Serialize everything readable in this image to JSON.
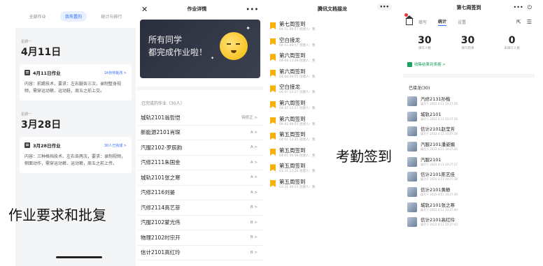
{
  "panel1": {
    "tabs": [
      "全部作业",
      "我布置的",
      "统计与排行"
    ],
    "groups": [
      {
        "weekday": "星期一",
        "date": "4月11日",
        "card_title": "4月11日作业",
        "card_link": "16份待批改 >",
        "card_body": "内容：前踢技术，要求：左右腿各三次，录制整身视频，需穿运动裤、运动鞋，周五之前上交。"
      },
      {
        "weekday": "星期一",
        "date": "3月28日",
        "card_title": "3月28日作业",
        "card_link": "30人已完成 >",
        "card_body": "内容：三种格挡技术、左右各两次，要求：录制视频，侧面动作，需穿运动裤、运动裤，周五之前上传。"
      }
    ],
    "caption": "作业要求和批复"
  },
  "panel2": {
    "title": "作业详情",
    "banner_line1": "所有同学",
    "banner_line2": "都完成作业啦！",
    "section_label": "已完成的作业（30人）",
    "rows": [
      {
        "name": "城轨2101翁哲恺",
        "grade": "待修正 >"
      },
      {
        "name": "新能源2101肖琛",
        "grade": "A >"
      },
      {
        "name": "汽服2102-罗辰韵",
        "grade": "A >"
      },
      {
        "name": "汽修2111朱国金",
        "grade": "A >"
      },
      {
        "name": "城轨2101张之寒",
        "grade": "A >"
      },
      {
        "name": "汽修2116刘晏",
        "grade": "A >"
      },
      {
        "name": "汽修2114高艺菲",
        "grade": "B >"
      },
      {
        "name": "汽服2102蒙光伟",
        "grade": "B >"
      },
      {
        "name": "物理2102时宗开",
        "grade": "B >"
      },
      {
        "name": "信计2101高红玲",
        "grade": "B >"
      }
    ]
  },
  "panel3": {
    "title": "腾讯文档接龙",
    "rows": [
      {
        "title": "第七周签到",
        "meta": "04-11 09:57 创建人：我"
      },
      {
        "title": "空白接龙",
        "meta": "04-11 09:57 创建人：我"
      },
      {
        "title": "第六周签到",
        "meta": "04-08 13:26 创建人：我"
      },
      {
        "title": "第六周签到",
        "meta": "04-08 09:55 创建人：我"
      },
      {
        "title": "空白接龙",
        "meta": "04-07 13:27 创建人：我"
      },
      {
        "title": "第六周签到",
        "meta": "04-02 13:27 创建人：我"
      },
      {
        "title": "第六周签到",
        "meta": "04-02 09:55 创建人：我"
      },
      {
        "title": "第五周签到",
        "meta": "04-01 13:25 创建人：我"
      },
      {
        "title": "第五周签到",
        "meta": "04-01 09:56 创建人：我"
      },
      {
        "title": "第五周签到",
        "meta": "03-31 13:26 创建人：我"
      },
      {
        "title": "第五周签到",
        "meta": "03-31 09:55 创建人：我"
      }
    ],
    "caption": "考勤签到"
  },
  "panel4": {
    "title": "第七周签到",
    "tabs": [
      "填写",
      "统计",
      "设置"
    ],
    "stats": [
      {
        "num": "30",
        "label": "填写人数"
      },
      {
        "num": "30",
        "label": "填写结果"
      },
      {
        "num": "0",
        "label": "未填写人数"
      }
    ],
    "export_label": "收集结果到表格 >",
    "section_label": "已接龙(30)",
    "rows": [
      {
        "name": "汽修2131孙楷",
        "time": "填写于 2022.4.11 10:27:26"
      },
      {
        "name": "城轨2101",
        "time": "填写于 2022.4.11 10:27:26"
      },
      {
        "name": "信计2101赵莹芳",
        "time": "填写于 2022.4.11 10:27:26"
      },
      {
        "name": "汽服2101潘姿媚",
        "time": "填写于 2022.4.11 10:27:26"
      },
      {
        "name": "汽服2101",
        "time": "填写于 2022.4.11 10:27:37"
      },
      {
        "name": "信计2101陈艺佳",
        "time": "填写于 2022.4.11 10:27:38"
      },
      {
        "name": "信计2101黄静",
        "time": "填写于 2022.4.11 10:27:39"
      },
      {
        "name": "城轨2101张之寒",
        "time": "填写于 2022.4.11 10:27:40"
      },
      {
        "name": "信计2101高红玲",
        "time": "填写于 2022.4.11 10:27:43"
      }
    ]
  }
}
